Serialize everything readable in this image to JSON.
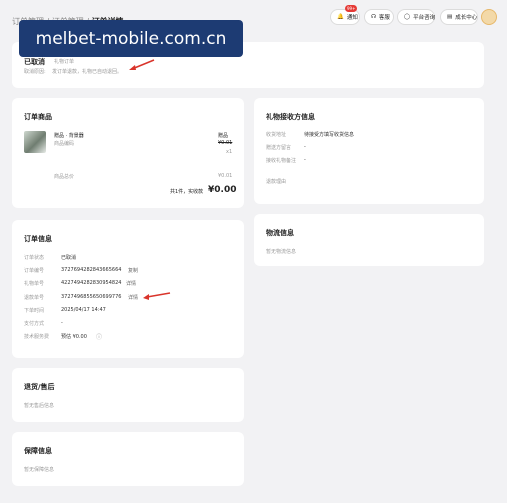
{
  "breadcrumb": {
    "part1": "订单管理 / 订单管理 / ",
    "current": "订单详情"
  },
  "nav": {
    "message_label": "通知",
    "message_badge": "99+",
    "service_label": "客服",
    "platform_label": "平台咨询",
    "growth_label": "成长中心"
  },
  "watermark": "melbet-mobile.com.cn",
  "status": {
    "title": "已取消",
    "tag": "礼物订单",
    "reason_label": "取消原因:",
    "reason_value": "发订单退款，礼物已自动退回。"
  },
  "goods": {
    "title": "订单商品",
    "item_name": "赠品 · 背景器",
    "item_code_label": "商品编码",
    "col_label": "赠品",
    "price": "¥0.01",
    "qty": "x1",
    "total_label": "商品总价",
    "total_value": "¥0.01",
    "sum_label": "共1件，实收款",
    "sum_value": "¥0.00"
  },
  "recipient": {
    "title": "礼物接收方信息",
    "rows": [
      {
        "label": "收货地址",
        "value": "待接受方填写收货信息"
      },
      {
        "label": "赠送方留言",
        "value": "-"
      },
      {
        "label": "接收礼物备注",
        "value": "-"
      },
      {
        "label": "退款理由",
        "value": ""
      }
    ]
  },
  "order": {
    "title": "订单信息",
    "rows": [
      {
        "label": "订单状态",
        "value": "已取消",
        "action": ""
      },
      {
        "label": "订单编号",
        "value": "3727694282843665664",
        "action": "复制"
      },
      {
        "label": "礼物单号",
        "value": "4227494282830954824",
        "action": "详情"
      },
      {
        "label": "退款单号",
        "value": "3727496855650699776",
        "action": "详情"
      },
      {
        "label": "下单时间",
        "value": "2025/04/17 14:47",
        "action": ""
      },
      {
        "label": "支付方式",
        "value": "-",
        "action": ""
      },
      {
        "label": "技术服务费",
        "value": "预估 ¥0.00",
        "action": ""
      }
    ]
  },
  "logistics": {
    "title": "物流信息",
    "empty": "暂无物流信息"
  },
  "aftersale": {
    "title": "退货/售后",
    "empty": "暂无售后信息"
  },
  "guarantee": {
    "title": "保障信息",
    "empty": "暂无保障信息"
  },
  "colors": {
    "accent_arrow": "#d9342b",
    "watermark_bg": "#1d3b73",
    "badge": "#e53935"
  }
}
